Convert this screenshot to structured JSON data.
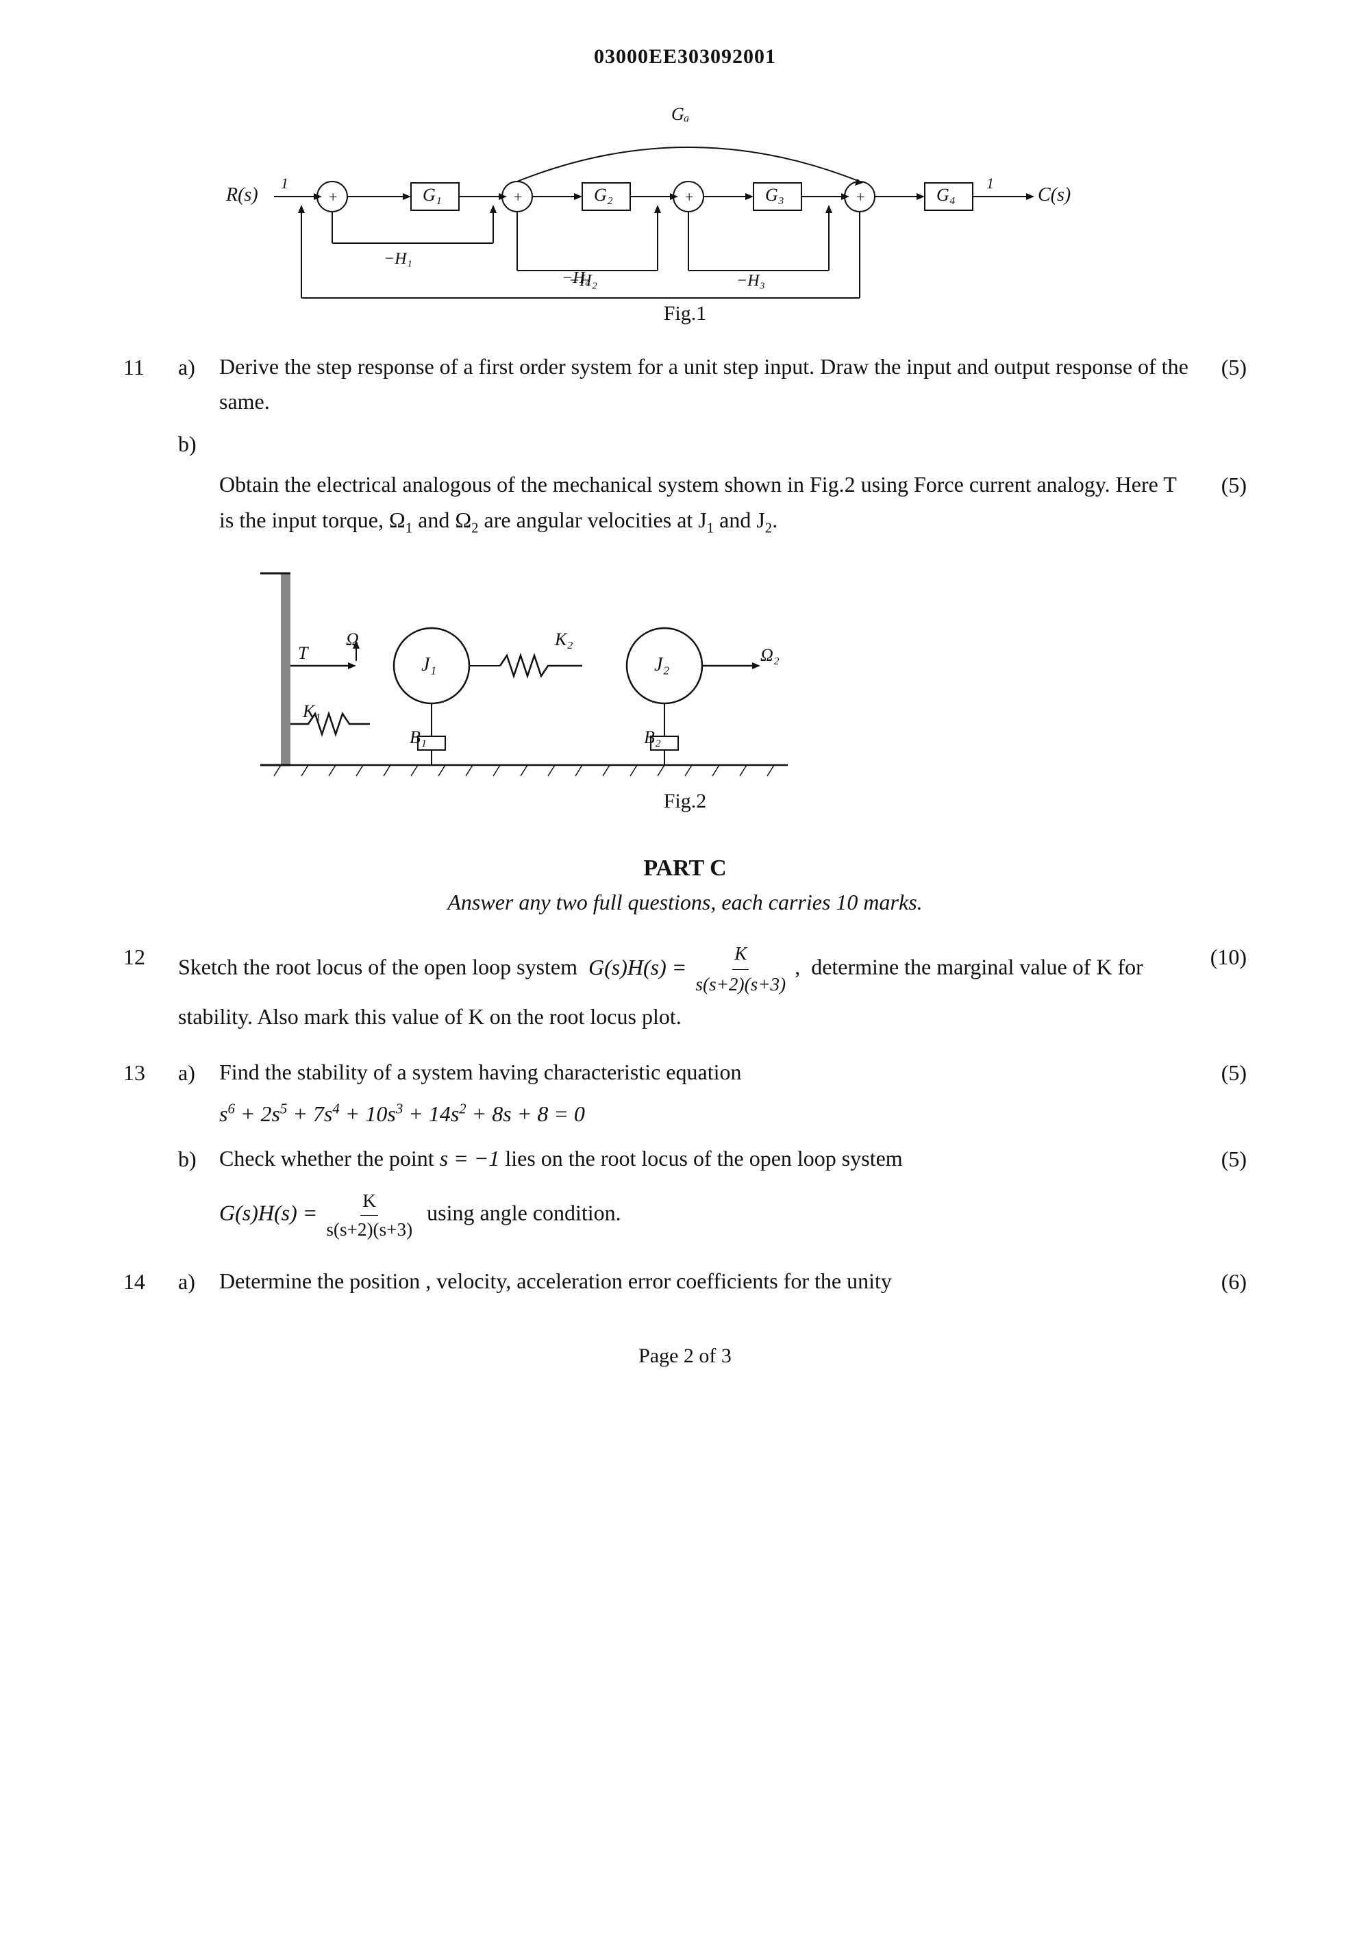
{
  "header": {
    "code": "03000EE303092001"
  },
  "fig1_label": "Fig.1",
  "fig2_label": "Fig.2",
  "questions": {
    "q11": {
      "num": "11",
      "a_label": "a)",
      "a_text": "Derive the step response of a first order system for a unit step input. Draw the input and output response of the same.",
      "a_marks": "(5)",
      "b_label": "b)",
      "b_text": "Obtain the electrical analogous of the mechanical system shown in Fig.2 using Force current analogy. Here T is the input torque, Ω₁ and Ω₂ are angular velocities at J₁ and J₂.",
      "b_marks": "(5)"
    },
    "part_c": {
      "title": "PART C",
      "subtitle": "Answer any two full questions, each carries 10 marks."
    },
    "q12": {
      "num": "12",
      "text_pre": "Sketch the root locus of the open loop system",
      "formula": "G(s)H(s) = K / s(s+2)(s+3)",
      "text_post": ", determine the marginal value of K for stability. Also mark this value of K on the root locus plot.",
      "marks": "(10)"
    },
    "q13": {
      "num": "13",
      "a_label": "a)",
      "a_text_pre": "Find the stability of a system having characteristic equation",
      "a_equation": "s⁶ + 2s⁵ + 7s⁴ + 10s³ + 14s² + 8s + 8 = 0",
      "a_marks": "(5)",
      "b_label": "b)",
      "b_text_pre": "Check whether the point s = −1 lies on the root locus of the open loop system",
      "b_formula": "G(s)H(s) = K / s(s+2)(s+3)",
      "b_text_post": "using angle condition.",
      "b_marks": "(5)"
    },
    "q14": {
      "num": "14",
      "a_label": "a)",
      "a_text": "Determine the position , velocity, acceleration error coefficients for the unity",
      "a_marks": "(6)"
    }
  },
  "footer": {
    "text": "Page 2 of 3"
  }
}
